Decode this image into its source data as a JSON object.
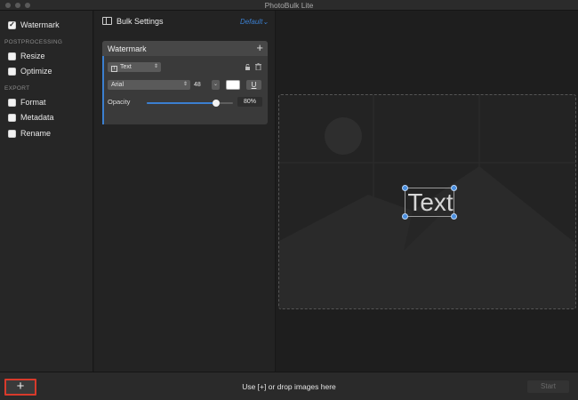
{
  "window": {
    "title": "PhotoBulk Lite"
  },
  "sidebar": {
    "items": [
      {
        "label": "Watermark",
        "checked": true
      },
      {
        "label": "Resize",
        "checked": false
      },
      {
        "label": "Optimize",
        "checked": false
      },
      {
        "label": "Format",
        "checked": false
      },
      {
        "label": "Metadata",
        "checked": false
      },
      {
        "label": "Rename",
        "checked": false
      }
    ],
    "sections": {
      "postprocessing": "POSTPROCESSING",
      "export": "EXPORT"
    }
  },
  "settings": {
    "title": "Bulk Settings",
    "preset": "Default",
    "watermark": {
      "title": "Watermark",
      "add_icon": "plus-icon",
      "type_select": "Text",
      "font_select": "Arial",
      "font_size": "48",
      "color": "#ffffff",
      "underline_label": "U",
      "opacity_label": "Opacity",
      "opacity_value": "80%",
      "opacity_level": 0.8
    }
  },
  "preview": {
    "watermark_text": "Text"
  },
  "bottom": {
    "add_label": "+",
    "hint": "Use [+] or drop images here",
    "start_label": "Start"
  },
  "colors": {
    "accent": "#3b7fd0",
    "highlight": "#d83a2b"
  }
}
